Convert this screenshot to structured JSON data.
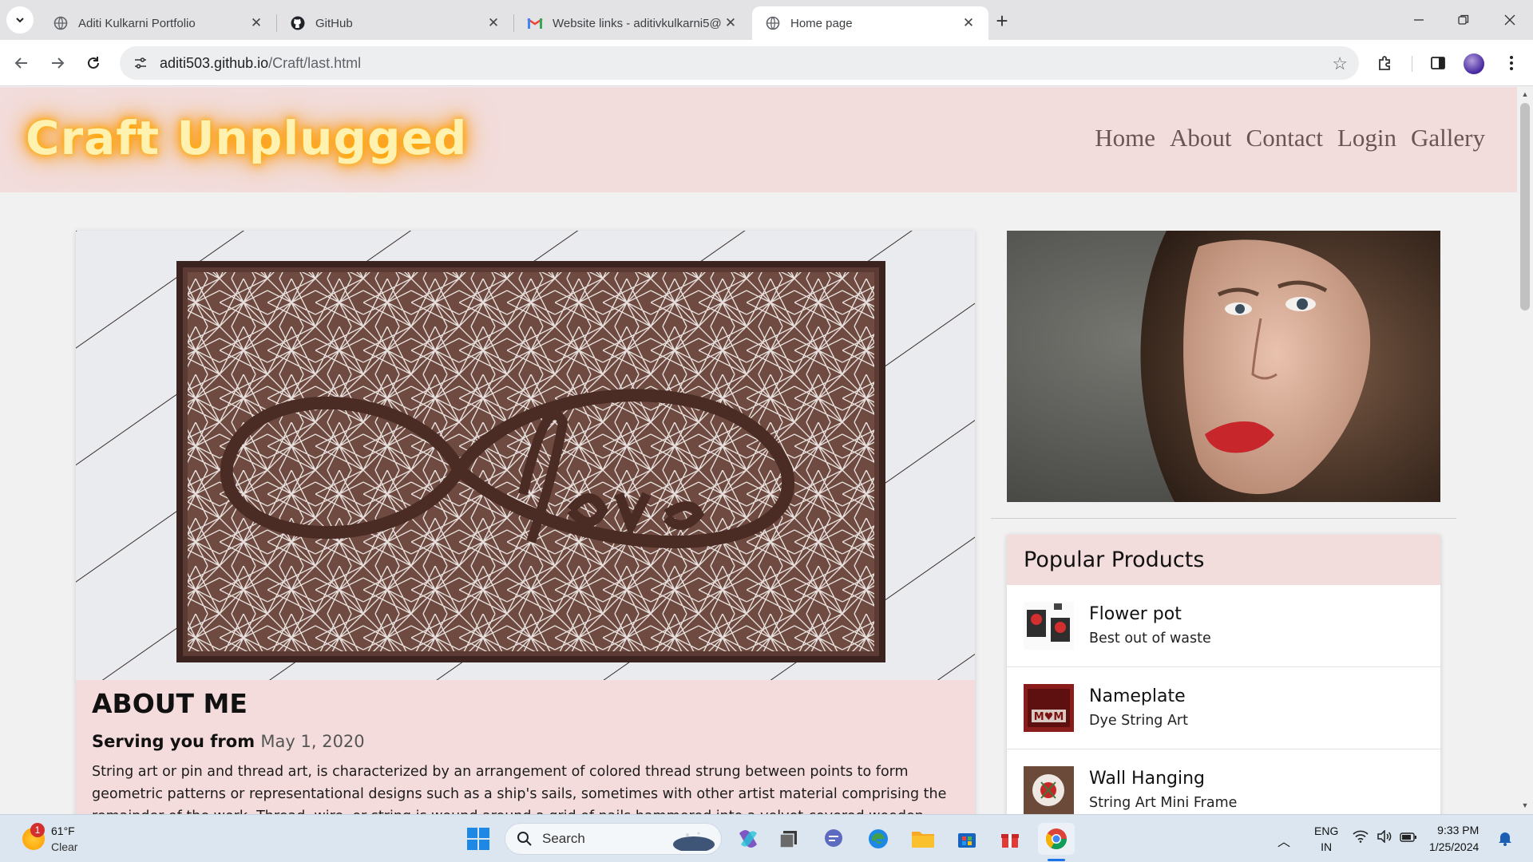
{
  "browser": {
    "tabs": [
      {
        "title": "Aditi Kulkarni Portfolio",
        "icon": "globe-icon"
      },
      {
        "title": "GitHub",
        "icon": "github-icon"
      },
      {
        "title": "Website links - aditivkulkarni5@",
        "icon": "gmail-icon"
      },
      {
        "title": "Home page",
        "icon": "globe-icon",
        "active": true
      }
    ],
    "url_host": "aditi503.github.io",
    "url_path": "/Craft/last.html"
  },
  "site": {
    "brand": "Craft Unplugged",
    "nav": [
      "Home",
      "About",
      "Contact",
      "Login",
      "Gallery"
    ],
    "about": {
      "heading": "ABOUT ME",
      "serving_label": "Serving you from",
      "serving_date": "May 1, 2020",
      "text": "String art or pin and thread art, is characterized by an arrangement of colored thread strung between points to form geometric patterns or representational designs such as a ship's sails, sometimes with other artist material comprising the remainder of the work. Thread, wire, or string is wound around a grid of nails hammered into a velvet-covered wooden board"
    },
    "popular": {
      "heading": "Popular Products",
      "items": [
        {
          "name": "Flower pot",
          "desc": "Best out of waste"
        },
        {
          "name": "Nameplate",
          "desc": "Dye String Art"
        },
        {
          "name": "Wall Hanging",
          "desc": "String Art Mini Frame"
        }
      ]
    },
    "colors": {
      "header_bg": "#f2dcdc",
      "brand_glow": "#ff9800",
      "nav_text": "#6b5454"
    }
  },
  "taskbar": {
    "weather_temp": "61°F",
    "weather_cond": "Clear",
    "weather_badge": "1",
    "search_placeholder": "Search",
    "lang_top": "ENG",
    "lang_bottom": "IN",
    "time": "9:33 PM",
    "date": "1/25/2024"
  }
}
